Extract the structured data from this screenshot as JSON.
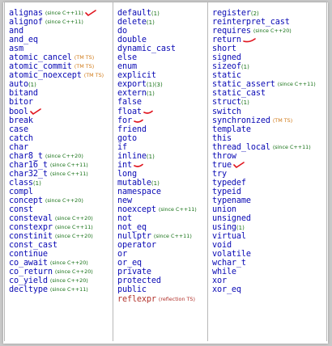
{
  "columns": [
    {
      "items": [
        {
          "keyword": "alignas",
          "note": "(since C++11)",
          "note_style": "std",
          "mark": "check"
        },
        {
          "keyword": "alignof",
          "note": "(since C++11)",
          "note_style": "std"
        },
        {
          "keyword": "and"
        },
        {
          "keyword": "and_eq"
        },
        {
          "keyword": "asm"
        },
        {
          "keyword": "atomic_cancel",
          "note": "(TM TS)",
          "note_style": "ts"
        },
        {
          "keyword": "atomic_commit",
          "note": "(TM TS)",
          "note_style": "ts"
        },
        {
          "keyword": "atomic_noexcept",
          "note": "(TM TS)",
          "note_style": "ts"
        },
        {
          "keyword": "auto",
          "suffix": "(1)"
        },
        {
          "keyword": "bitand"
        },
        {
          "keyword": "bitor"
        },
        {
          "keyword": "bool",
          "mark": "check"
        },
        {
          "keyword": "break"
        },
        {
          "keyword": "case"
        },
        {
          "keyword": "catch"
        },
        {
          "keyword": "char"
        },
        {
          "keyword": "char8_t",
          "note": "(since C++20)",
          "note_style": "std"
        },
        {
          "keyword": "char16_t",
          "note": "(since C++11)",
          "note_style": "std"
        },
        {
          "keyword": "char32_t",
          "note": "(since C++11)",
          "note_style": "std"
        },
        {
          "keyword": "class",
          "suffix": "(1)"
        },
        {
          "keyword": "compl"
        },
        {
          "keyword": "concept",
          "note": "(since C++20)",
          "note_style": "std"
        },
        {
          "keyword": "const"
        },
        {
          "keyword": "consteval",
          "note": "(since C++20)",
          "note_style": "std"
        },
        {
          "keyword": "constexpr",
          "note": "(since C++11)",
          "note_style": "std"
        },
        {
          "keyword": "constinit",
          "note": "(since C++20)",
          "note_style": "std"
        },
        {
          "keyword": "const_cast"
        },
        {
          "keyword": "continue"
        },
        {
          "keyword": "co_await",
          "note": "(since C++20)",
          "note_style": "std"
        },
        {
          "keyword": "co_return",
          "note": "(since C++20)",
          "note_style": "std"
        },
        {
          "keyword": "co_yield",
          "note": "(since C++20)",
          "note_style": "std"
        },
        {
          "keyword": "decltype",
          "note": "(since C++11)",
          "note_style": "std"
        }
      ]
    },
    {
      "items": [
        {
          "keyword": "default",
          "suffix": "(1)"
        },
        {
          "keyword": "delete",
          "suffix": "(1)"
        },
        {
          "keyword": "do"
        },
        {
          "keyword": "double"
        },
        {
          "keyword": "dynamic_cast"
        },
        {
          "keyword": "else"
        },
        {
          "keyword": "enum"
        },
        {
          "keyword": "explicit"
        },
        {
          "keyword": "export",
          "suffix": "(1)(3)"
        },
        {
          "keyword": "extern",
          "suffix": "(1)"
        },
        {
          "keyword": "false"
        },
        {
          "keyword": "float",
          "mark": "dash"
        },
        {
          "keyword": "for",
          "mark": "dash"
        },
        {
          "keyword": "friend"
        },
        {
          "keyword": "goto"
        },
        {
          "keyword": "if"
        },
        {
          "keyword": "inline",
          "suffix": "(1)"
        },
        {
          "keyword": "int",
          "mark": "dash"
        },
        {
          "keyword": "long"
        },
        {
          "keyword": "mutable",
          "suffix": "(1)"
        },
        {
          "keyword": "namespace"
        },
        {
          "keyword": "new"
        },
        {
          "keyword": "noexcept",
          "note": "(since C++11)",
          "note_style": "std"
        },
        {
          "keyword": "not"
        },
        {
          "keyword": "not_eq"
        },
        {
          "keyword": "nullptr",
          "note": "(since C++11)",
          "note_style": "std"
        },
        {
          "keyword": "operator"
        },
        {
          "keyword": "or"
        },
        {
          "keyword": "or_eq"
        },
        {
          "keyword": "private"
        },
        {
          "keyword": "protected"
        },
        {
          "keyword": "public"
        },
        {
          "keyword": "reflexpr",
          "note": "(reflection TS)",
          "note_style": "refl",
          "keyword_style": "refl"
        }
      ]
    },
    {
      "items": [
        {
          "keyword": "register",
          "suffix": "(2)"
        },
        {
          "keyword": "reinterpret_cast"
        },
        {
          "keyword": "requires",
          "note": "(since C++20)",
          "note_style": "std"
        },
        {
          "keyword": "return",
          "mark": "dash-under"
        },
        {
          "keyword": "short"
        },
        {
          "keyword": "signed"
        },
        {
          "keyword": "sizeof",
          "suffix": "(1)"
        },
        {
          "keyword": "static"
        },
        {
          "keyword": "static_assert",
          "note": "(since C++11)",
          "note_style": "std"
        },
        {
          "keyword": "static_cast"
        },
        {
          "keyword": "struct",
          "suffix": "(1)"
        },
        {
          "keyword": "switch"
        },
        {
          "keyword": "synchronized",
          "note": "(TM TS)",
          "note_style": "ts"
        },
        {
          "keyword": "template"
        },
        {
          "keyword": "this"
        },
        {
          "keyword": "thread_local",
          "note": "(since C++11)",
          "note_style": "std"
        },
        {
          "keyword": "throw"
        },
        {
          "keyword": "true",
          "mark": "check"
        },
        {
          "keyword": "try"
        },
        {
          "keyword": "typedef"
        },
        {
          "keyword": "typeid"
        },
        {
          "keyword": "typename"
        },
        {
          "keyword": "union"
        },
        {
          "keyword": "unsigned"
        },
        {
          "keyword": "using",
          "suffix": "(1)"
        },
        {
          "keyword": "virtual"
        },
        {
          "keyword": "void"
        },
        {
          "keyword": "volatile"
        },
        {
          "keyword": "wchar_t"
        },
        {
          "keyword": "while"
        },
        {
          "keyword": "xor"
        },
        {
          "keyword": "xor_eq"
        }
      ]
    }
  ],
  "colors": {
    "keyword": "#0b0bb5",
    "since_note": "#157015",
    "ts_note": "#d07a18",
    "reflection": "#b2322b",
    "annotation_mark": "#e0141e"
  },
  "mark_icons": {
    "check": "red-checkmark-icon",
    "dash": "red-underline-mark-icon",
    "dash-under": "red-underline-mark-icon"
  }
}
